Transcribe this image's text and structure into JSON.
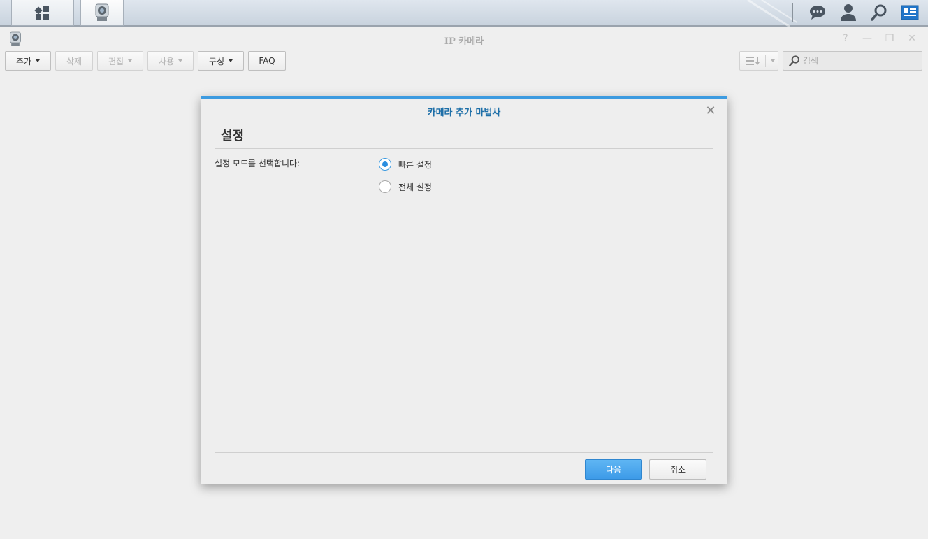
{
  "window": {
    "title": "IP 카메라"
  },
  "toolbar": {
    "add": "추가",
    "delete": "삭제",
    "edit": "편집",
    "use": "사용",
    "config": "구성",
    "faq": "FAQ",
    "search_placeholder": "검색"
  },
  "dialog": {
    "title": "카메라 추가 마법사",
    "heading": "설정",
    "mode_label": "설정 모드를 선택합니다:",
    "options": [
      {
        "label": "빠른 설정",
        "checked": true
      },
      {
        "label": "전체 설정",
        "checked": false
      }
    ],
    "next": "다음",
    "cancel": "취소"
  },
  "colors": {
    "accent": "#3d9be0",
    "title_blue": "#1e6fa8"
  }
}
